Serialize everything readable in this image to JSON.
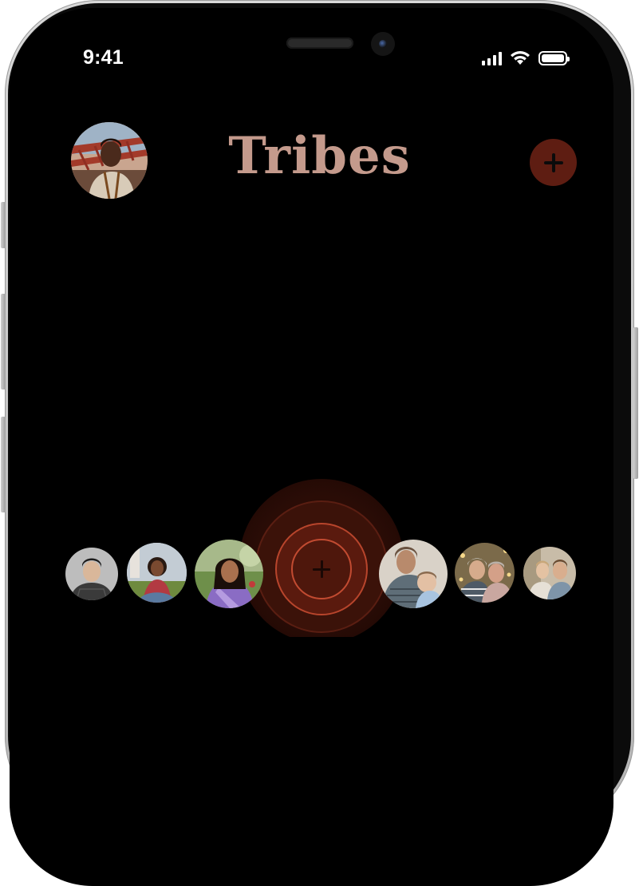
{
  "status_bar": {
    "time": "9:41",
    "signal_icon": "cellular-signal-icon",
    "wifi_icon": "wifi-icon",
    "battery_icon": "battery-full-icon"
  },
  "header": {
    "title": "Tribes",
    "profile_avatar": "profile-avatar",
    "add_button_icon": "plus-icon"
  },
  "tribe_strip": {
    "center_button_icon": "plus-icon",
    "members": [
      "member-avatar-1",
      "member-avatar-2",
      "member-avatar-3",
      "member-avatar-4",
      "member-avatar-5",
      "member-avatar-6"
    ]
  },
  "colors": {
    "background": "#000000",
    "title": "#c49a8c",
    "accent": "#5e1d12",
    "ring": "#c24b31"
  }
}
